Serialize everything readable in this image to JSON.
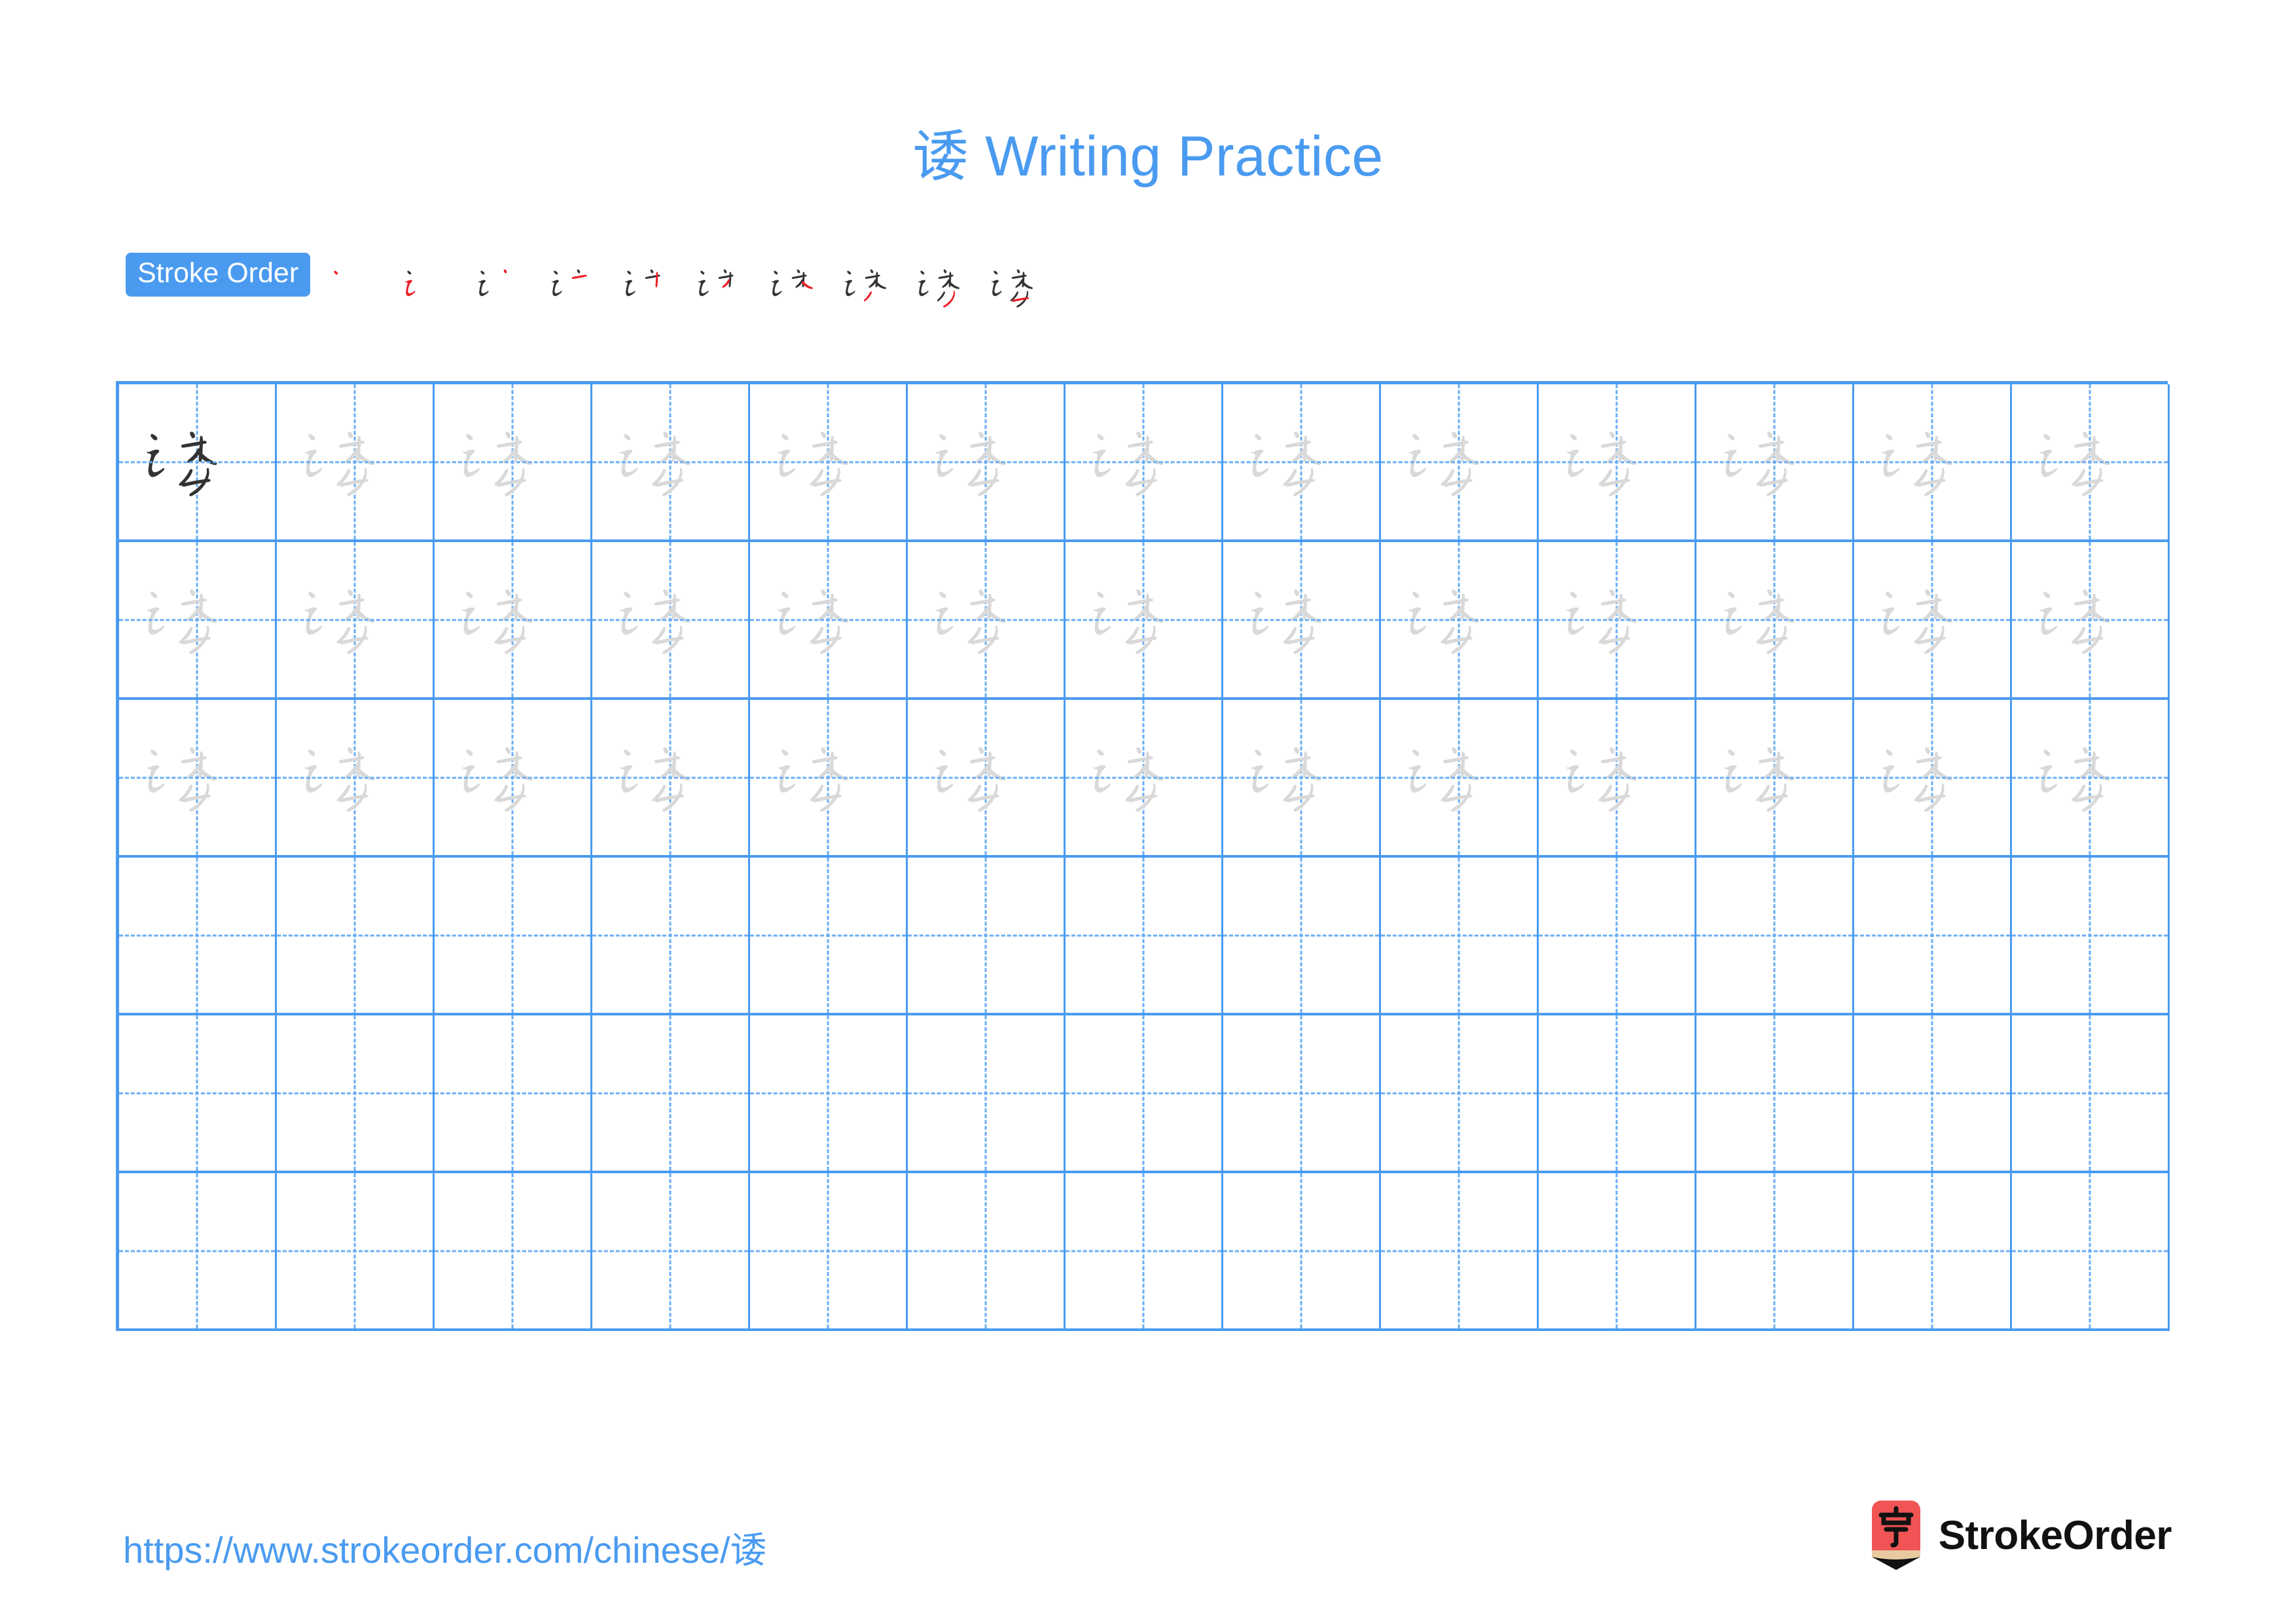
{
  "character": "诿",
  "title": "诿 Writing Practice",
  "stroke_order": {
    "badge_label": "Stroke Order",
    "total_strokes": 10,
    "steps": [
      {
        "index": 1,
        "glyph": "诿",
        "new_stroke": "dot (点)"
      },
      {
        "index": 2,
        "glyph": "诿",
        "new_stroke": "horizontal-fold-fold (横折提)"
      },
      {
        "index": 3,
        "glyph": "诿",
        "new_stroke": "downward-left (撇)"
      },
      {
        "index": 4,
        "glyph": "诿",
        "new_stroke": "horizontal (横)"
      },
      {
        "index": 5,
        "glyph": "诿",
        "new_stroke": "vertical (竖)"
      },
      {
        "index": 6,
        "glyph": "诿",
        "new_stroke": "downward-left (撇)"
      },
      {
        "index": 7,
        "glyph": "诿",
        "new_stroke": "downward-right (捺)"
      },
      {
        "index": 8,
        "glyph": "诿",
        "new_stroke": "downward-left-fold (撇折)"
      },
      {
        "index": 9,
        "glyph": "诿",
        "new_stroke": "downward-left (撇)"
      },
      {
        "index": 10,
        "glyph": "诿",
        "new_stroke": "horizontal (横)"
      }
    ]
  },
  "practice_grid": {
    "columns": 13,
    "rows": 6,
    "rows_data": [
      {
        "row": 1,
        "cells": [
          "dark",
          "light",
          "light",
          "light",
          "light",
          "light",
          "light",
          "light",
          "light",
          "light",
          "light",
          "light",
          "light"
        ]
      },
      {
        "row": 2,
        "cells": [
          "light",
          "light",
          "light",
          "light",
          "light",
          "light",
          "light",
          "light",
          "light",
          "light",
          "light",
          "light",
          "light"
        ]
      },
      {
        "row": 3,
        "cells": [
          "light",
          "light",
          "light",
          "light",
          "light",
          "light",
          "light",
          "light",
          "light",
          "light",
          "light",
          "light",
          "light"
        ]
      },
      {
        "row": 4,
        "cells": [
          "empty",
          "empty",
          "empty",
          "empty",
          "empty",
          "empty",
          "empty",
          "empty",
          "empty",
          "empty",
          "empty",
          "empty",
          "empty"
        ]
      },
      {
        "row": 5,
        "cells": [
          "empty",
          "empty",
          "empty",
          "empty",
          "empty",
          "empty",
          "empty",
          "empty",
          "empty",
          "empty",
          "empty",
          "empty",
          "empty"
        ]
      },
      {
        "row": 6,
        "cells": [
          "empty",
          "empty",
          "empty",
          "empty",
          "empty",
          "empty",
          "empty",
          "empty",
          "empty",
          "empty",
          "empty",
          "empty",
          "empty"
        ]
      }
    ]
  },
  "footer": {
    "url": "https://www.strokeorder.com/chinese/诿",
    "brand_name": "StrokeOrder",
    "brand_mark_char": "字"
  },
  "colors": {
    "accent_blue": "#4a9bf0",
    "grid_line": "#4a9bf0",
    "guide_line": "#6aaef5",
    "char_dark": "#333333",
    "char_light": "#d9d9d9",
    "stroke_new": "#ee1c25",
    "logo_red": "#f05454",
    "logo_wood": "#e8c9a0"
  }
}
